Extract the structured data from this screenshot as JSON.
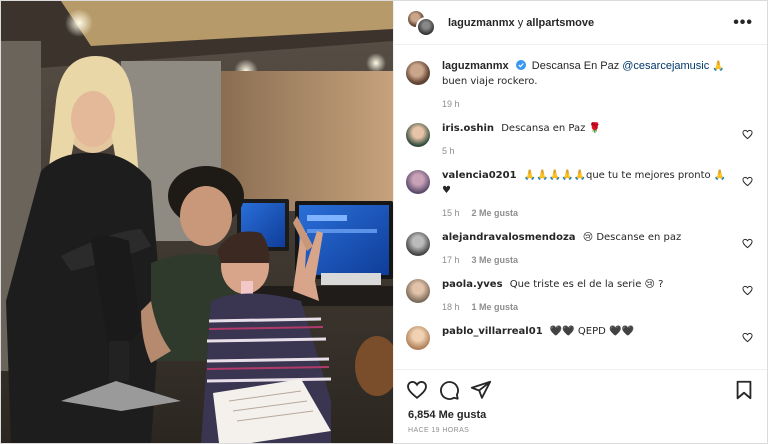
{
  "header": {
    "user1": "laguzmanmx",
    "conjunction": "y",
    "user2": "allpartsmove",
    "more_label": "•••"
  },
  "caption": {
    "user": "laguzmanmx",
    "text_before": "Descansa En Paz",
    "mention": "@cesarcejamusic",
    "text_after": "🙏 buen viaje rockero.",
    "time": "19 h"
  },
  "comments": [
    {
      "user": "iris.oshin",
      "text": "Descansa en Paz 🌹",
      "time": "5 h",
      "likes": "",
      "reply": "",
      "avatar_color": "#2f4a3a"
    },
    {
      "user": "valencia0201",
      "text": "🙏🙏🙏🙏🙏que tu te mejores pronto 🙏♥",
      "time": "15 h",
      "likes": "2 Me gusta",
      "reply": "",
      "avatar_color": "#5a4a6a"
    },
    {
      "user": "alejandravalosmendoza",
      "text": "😢 Descanse en paz",
      "time": "17 h",
      "likes": "3 Me gusta",
      "reply": "",
      "avatar_color": "#444444"
    },
    {
      "user": "paola.yves",
      "text": "Que triste es el de la serie 😢 ?",
      "time": "18 h",
      "likes": "1 Me gusta",
      "reply": "",
      "avatar_color": "#7a6a5a"
    },
    {
      "user": "pablo_villarreal01",
      "text": "🖤🖤 QEPD 🖤🖤",
      "time": "",
      "likes": "",
      "reply": "",
      "avatar_color": "#b0805a"
    }
  ],
  "footer": {
    "likes": "6,854 Me gusta",
    "timestamp": "HACE 19 HORAS"
  },
  "icons": {
    "like": "heart-icon",
    "comment": "comment-icon",
    "share": "send-icon",
    "save": "bookmark-icon",
    "verified": "verified-badge-icon"
  },
  "colors": {
    "link": "#00376b",
    "verified": "#3897f0",
    "muted": "#8e8e8e"
  }
}
